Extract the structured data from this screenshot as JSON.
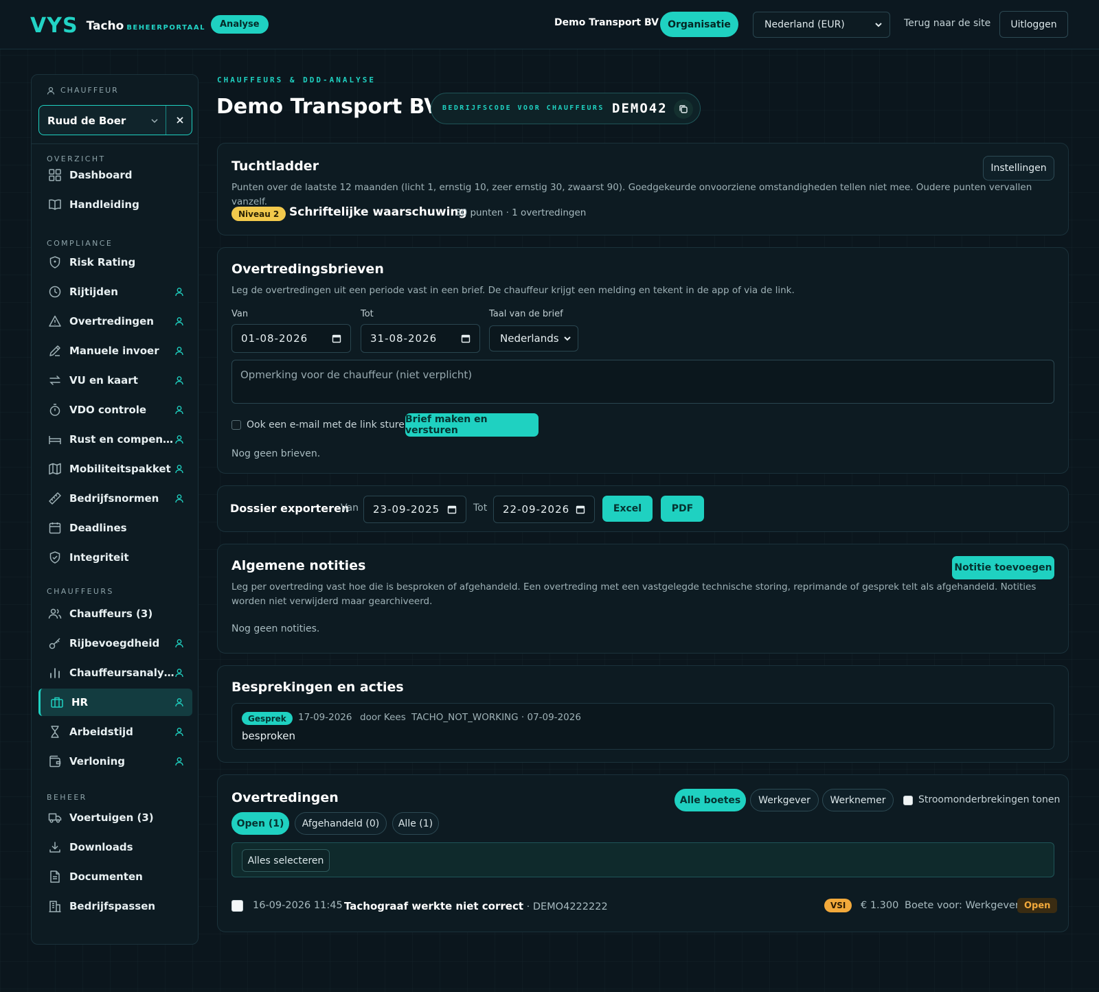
{
  "header": {
    "logo_mark": "VYS",
    "logo_name": "Tacho",
    "logo_sub": "BEHEERPORTAAL",
    "mode_badge": "Analyse",
    "company": "Demo Transport BV",
    "org_button": "Organisatie",
    "country_select": "Nederland (EUR)",
    "back_link": "Terug naar de site",
    "logout": "Uitloggen"
  },
  "sidebar": {
    "chauffeur_label": "CHAUFFEUR",
    "selected_driver": "Ruud de Boer",
    "sections": {
      "overzicht": "OVERZICHT",
      "compliance": "COMPLIANCE",
      "chauffeurs": "CHAUFFEURS",
      "beheer": "BEHEER"
    },
    "items": [
      {
        "label": "Dashboard",
        "icon": "grid-icon"
      },
      {
        "label": "Handleiding",
        "icon": "book-icon"
      },
      {
        "label": "Risk Rating",
        "icon": "shield-icon"
      },
      {
        "label": "Rijtijden",
        "icon": "clock-icon"
      },
      {
        "label": "Overtredingen",
        "icon": "warning-icon"
      },
      {
        "label": "Manuele invoer",
        "icon": "pencil-icon"
      },
      {
        "label": "VU en kaart",
        "icon": "swap-icon"
      },
      {
        "label": "VDO controle",
        "icon": "stopwatch-icon"
      },
      {
        "label": "Rust en compen…",
        "icon": "bed-icon"
      },
      {
        "label": "Mobiliteitspakket",
        "icon": "map-icon"
      },
      {
        "label": "Bedrijfsnormen",
        "icon": "ruler-icon"
      },
      {
        "label": "Deadlines",
        "icon": "calendar-icon"
      },
      {
        "label": "Integriteit",
        "icon": "shield-check-icon"
      },
      {
        "label": "Chauffeurs (3)",
        "icon": "users-icon"
      },
      {
        "label": "Rijbevoegdheid",
        "icon": "key-icon"
      },
      {
        "label": "Chauffeursanaly…",
        "icon": "bar-chart-icon"
      },
      {
        "label": "HR",
        "icon": "briefcase-icon"
      },
      {
        "label": "Arbeidstijd",
        "icon": "hourglass-icon"
      },
      {
        "label": "Verloning",
        "icon": "wallet-icon"
      },
      {
        "label": "Voertuigen (3)",
        "icon": "truck-icon"
      },
      {
        "label": "Downloads",
        "icon": "download-icon"
      },
      {
        "label": "Documenten",
        "icon": "document-icon"
      },
      {
        "label": "Bedrijfspassen",
        "icon": "building-icon"
      }
    ],
    "active_item": "HR"
  },
  "main": {
    "eyebrow": "CHAUFFEURS & DDD-ANALYSE",
    "title": "Demo Transport BV",
    "company_code_label": "BEDRIJFSCODE VOOR CHAUFFEURS",
    "company_code": "DEMO42"
  },
  "tuchtladder": {
    "title": "Tuchtladder",
    "settings_button": "Instellingen",
    "description": "Punten over de laatste 12 maanden (licht 1, ernstig 10, zeer ernstig 30, zwaarst 90). Goedgekeurde onvoorziene omstandigheden tellen niet mee. Oudere punten vervallen vanzelf.",
    "level_badge": "Niveau 2",
    "level_name": "Schriftelijke waarschuwing",
    "level_meta": "30 punten · 1 overtredingen"
  },
  "brieven": {
    "title": "Overtredingsbrieven",
    "description": "Leg de overtredingen uit een periode vast in een brief. De chauffeur krijgt een melding en tekent in de app of via de link.",
    "from_label": "Van",
    "from_value": "01-08-2026",
    "to_label": "Tot",
    "to_value": "31-08-2026",
    "language_label": "Taal van de brief",
    "language_value": "Nederlands",
    "remark_placeholder": "Opmerking voor de chauffeur (niet verplicht)",
    "email_checkbox": "Ook een e-mail met de link sturen",
    "submit": "Brief maken en versturen",
    "empty": "Nog geen brieven."
  },
  "export": {
    "title": "Dossier exporteren",
    "from_label": "Van",
    "from_value": "23-09-2025",
    "to_label": "Tot",
    "to_value": "22-09-2026",
    "excel": "Excel",
    "pdf": "PDF"
  },
  "notities": {
    "title": "Algemene notities",
    "add_button": "Notitie toevoegen",
    "description": "Leg per overtreding vast hoe die is besproken of afgehandeld. Een overtreding met een vastgelegde technische storing, reprimande of gesprek telt als afgehandeld. Notities worden niet verwijderd maar gearchiveerd.",
    "empty": "Nog geen notities."
  },
  "besprekingen": {
    "title": "Besprekingen en acties",
    "item": {
      "type": "Gesprek",
      "date": "17-09-2026",
      "by": "door Kees",
      "ref": "TACHO_NOT_WORKING · 07-09-2026",
      "text": "besproken"
    }
  },
  "overtredingen": {
    "title": "Overtredingen",
    "fine_filters": [
      "Alle boetes",
      "Werkgever",
      "Werknemer"
    ],
    "power_checkbox": "Stroomonderbrekingen tonen",
    "status_tabs": [
      "Open (1)",
      "Afgehandeld (0)",
      "Alle (1)"
    ],
    "select_all": "Alles selecteren",
    "rows": [
      {
        "datetime": "16-09-2026 11:45",
        "title": "Tachograaf werkte niet correct",
        "vehicle": "· DEMO4222222",
        "source": "VSI",
        "amount": "€ 1.300",
        "fine_for": "Boete voor: Werkgever",
        "status": "Open"
      }
    ]
  },
  "colors": {
    "accent": "#1fd1c1",
    "background": "#0b161d",
    "warning": "#f2c94c",
    "orange": "#f2a93b"
  }
}
